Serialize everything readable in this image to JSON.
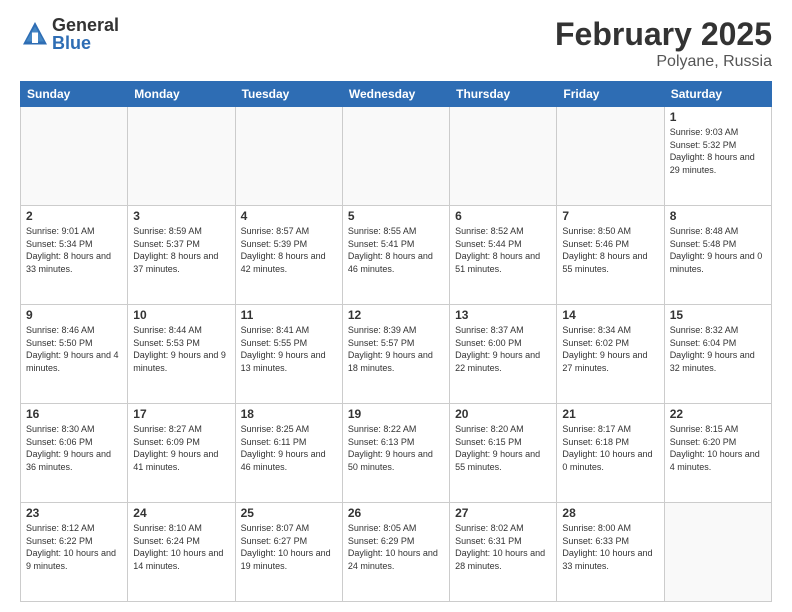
{
  "logo": {
    "general": "General",
    "blue": "Blue"
  },
  "title": "February 2025",
  "subtitle": "Polyane, Russia",
  "days_of_week": [
    "Sunday",
    "Monday",
    "Tuesday",
    "Wednesday",
    "Thursday",
    "Friday",
    "Saturday"
  ],
  "weeks": [
    [
      {
        "day": "",
        "info": ""
      },
      {
        "day": "",
        "info": ""
      },
      {
        "day": "",
        "info": ""
      },
      {
        "day": "",
        "info": ""
      },
      {
        "day": "",
        "info": ""
      },
      {
        "day": "",
        "info": ""
      },
      {
        "day": "1",
        "info": "Sunrise: 9:03 AM\nSunset: 5:32 PM\nDaylight: 8 hours and 29 minutes."
      }
    ],
    [
      {
        "day": "2",
        "info": "Sunrise: 9:01 AM\nSunset: 5:34 PM\nDaylight: 8 hours and 33 minutes."
      },
      {
        "day": "3",
        "info": "Sunrise: 8:59 AM\nSunset: 5:37 PM\nDaylight: 8 hours and 37 minutes."
      },
      {
        "day": "4",
        "info": "Sunrise: 8:57 AM\nSunset: 5:39 PM\nDaylight: 8 hours and 42 minutes."
      },
      {
        "day": "5",
        "info": "Sunrise: 8:55 AM\nSunset: 5:41 PM\nDaylight: 8 hours and 46 minutes."
      },
      {
        "day": "6",
        "info": "Sunrise: 8:52 AM\nSunset: 5:44 PM\nDaylight: 8 hours and 51 minutes."
      },
      {
        "day": "7",
        "info": "Sunrise: 8:50 AM\nSunset: 5:46 PM\nDaylight: 8 hours and 55 minutes."
      },
      {
        "day": "8",
        "info": "Sunrise: 8:48 AM\nSunset: 5:48 PM\nDaylight: 9 hours and 0 minutes."
      }
    ],
    [
      {
        "day": "9",
        "info": "Sunrise: 8:46 AM\nSunset: 5:50 PM\nDaylight: 9 hours and 4 minutes."
      },
      {
        "day": "10",
        "info": "Sunrise: 8:44 AM\nSunset: 5:53 PM\nDaylight: 9 hours and 9 minutes."
      },
      {
        "day": "11",
        "info": "Sunrise: 8:41 AM\nSunset: 5:55 PM\nDaylight: 9 hours and 13 minutes."
      },
      {
        "day": "12",
        "info": "Sunrise: 8:39 AM\nSunset: 5:57 PM\nDaylight: 9 hours and 18 minutes."
      },
      {
        "day": "13",
        "info": "Sunrise: 8:37 AM\nSunset: 6:00 PM\nDaylight: 9 hours and 22 minutes."
      },
      {
        "day": "14",
        "info": "Sunrise: 8:34 AM\nSunset: 6:02 PM\nDaylight: 9 hours and 27 minutes."
      },
      {
        "day": "15",
        "info": "Sunrise: 8:32 AM\nSunset: 6:04 PM\nDaylight: 9 hours and 32 minutes."
      }
    ],
    [
      {
        "day": "16",
        "info": "Sunrise: 8:30 AM\nSunset: 6:06 PM\nDaylight: 9 hours and 36 minutes."
      },
      {
        "day": "17",
        "info": "Sunrise: 8:27 AM\nSunset: 6:09 PM\nDaylight: 9 hours and 41 minutes."
      },
      {
        "day": "18",
        "info": "Sunrise: 8:25 AM\nSunset: 6:11 PM\nDaylight: 9 hours and 46 minutes."
      },
      {
        "day": "19",
        "info": "Sunrise: 8:22 AM\nSunset: 6:13 PM\nDaylight: 9 hours and 50 minutes."
      },
      {
        "day": "20",
        "info": "Sunrise: 8:20 AM\nSunset: 6:15 PM\nDaylight: 9 hours and 55 minutes."
      },
      {
        "day": "21",
        "info": "Sunrise: 8:17 AM\nSunset: 6:18 PM\nDaylight: 10 hours and 0 minutes."
      },
      {
        "day": "22",
        "info": "Sunrise: 8:15 AM\nSunset: 6:20 PM\nDaylight: 10 hours and 4 minutes."
      }
    ],
    [
      {
        "day": "23",
        "info": "Sunrise: 8:12 AM\nSunset: 6:22 PM\nDaylight: 10 hours and 9 minutes."
      },
      {
        "day": "24",
        "info": "Sunrise: 8:10 AM\nSunset: 6:24 PM\nDaylight: 10 hours and 14 minutes."
      },
      {
        "day": "25",
        "info": "Sunrise: 8:07 AM\nSunset: 6:27 PM\nDaylight: 10 hours and 19 minutes."
      },
      {
        "day": "26",
        "info": "Sunrise: 8:05 AM\nSunset: 6:29 PM\nDaylight: 10 hours and 24 minutes."
      },
      {
        "day": "27",
        "info": "Sunrise: 8:02 AM\nSunset: 6:31 PM\nDaylight: 10 hours and 28 minutes."
      },
      {
        "day": "28",
        "info": "Sunrise: 8:00 AM\nSunset: 6:33 PM\nDaylight: 10 hours and 33 minutes."
      },
      {
        "day": "",
        "info": ""
      }
    ]
  ]
}
